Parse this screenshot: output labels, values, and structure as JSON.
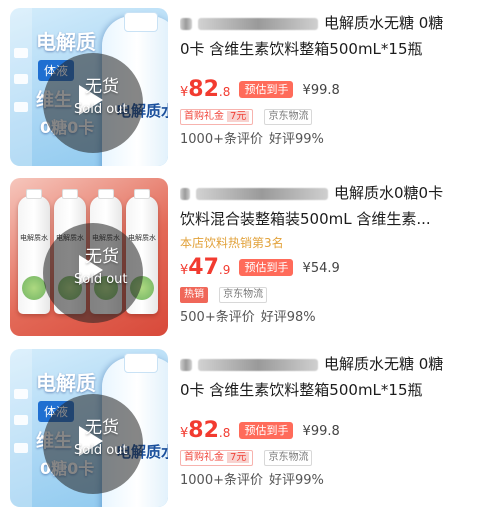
{
  "colors": {
    "price": "#f23b30",
    "estimate_tag": "#ff6b5a",
    "rank": "#e2a23b"
  },
  "products": [
    {
      "thumb_style": "blue",
      "thumb_texts": {
        "line1": "电解质",
        "tag": "体液",
        "line3": "维生",
        "line4": "0糖0卡",
        "bottle_label": "电解质水"
      },
      "overlay": {
        "status": "无货",
        "status_en": "Sold out"
      },
      "title_line1": "电解质水无糖 0糖",
      "title_line2": "0卡 含维生素饮料整箱500mL*15瓶",
      "price_symbol": "¥",
      "price_int": "82",
      "price_dec": ".8",
      "estimate_label": "预估到手",
      "original_price": "¥99.8",
      "promo_label": "首购礼金",
      "promo_amount": "7元",
      "logistics": "京东物流",
      "review_count": "1000+条评价",
      "good_rate": "好评99%"
    },
    {
      "thumb_style": "red",
      "thumb_texts": {
        "bottle_label": "电解质水"
      },
      "overlay": {
        "status": "无货",
        "status_en": "Sold out"
      },
      "title_line1": "电解质水0糖0卡",
      "title_line2": "饮料混合装整箱装500mL 含维生素...",
      "rank": "本店饮料热销第3名",
      "price_symbol": "¥",
      "price_int": "47",
      "price_dec": ".9",
      "estimate_label": "预估到手",
      "original_price": "¥54.9",
      "hot_label": "热销",
      "logistics": "京东物流",
      "review_count": "500+条评价",
      "good_rate": "好评98%"
    },
    {
      "thumb_style": "blue",
      "thumb_texts": {
        "line1": "电解质",
        "tag": "体液",
        "line3": "维生",
        "line4": "0糖0卡",
        "bottle_label": "电解质水"
      },
      "overlay": {
        "status": "无货",
        "status_en": "Sold out"
      },
      "title_line1": "电解质水无糖 0糖",
      "title_line2": "0卡 含维生素饮料整箱500mL*15瓶",
      "price_symbol": "¥",
      "price_int": "82",
      "price_dec": ".8",
      "estimate_label": "预估到手",
      "original_price": "¥99.8",
      "promo_label": "首购礼金",
      "promo_amount": "7元",
      "logistics": "京东物流",
      "review_count": "1000+条评价",
      "good_rate": "好评99%"
    }
  ]
}
